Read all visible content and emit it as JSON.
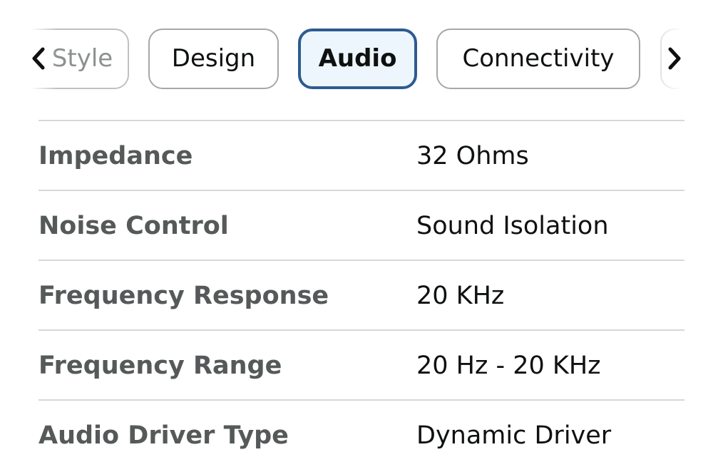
{
  "tabs": [
    {
      "label": "Style"
    },
    {
      "label": "Design"
    },
    {
      "label": "Audio",
      "selected": true
    },
    {
      "label": "Connectivity"
    }
  ],
  "icons": {
    "prev": "chevron-left-icon",
    "next": "chevron-right-icon"
  },
  "specs": [
    {
      "name": "Impedance",
      "value": "32 Ohms"
    },
    {
      "name": "Noise Control",
      "value": "Sound Isolation"
    },
    {
      "name": "Frequency Response",
      "value": "20 KHz"
    },
    {
      "name": "Frequency Range",
      "value": "20 Hz - 20 KHz"
    },
    {
      "name": "Audio Driver Type",
      "value": "Dynamic Driver"
    }
  ],
  "colors": {
    "selected_border": "#2d5b91",
    "selected_fill": "#edf6fc",
    "label_text": "#565959",
    "value_text": "#0f1111",
    "divider": "#d5d9d9"
  }
}
